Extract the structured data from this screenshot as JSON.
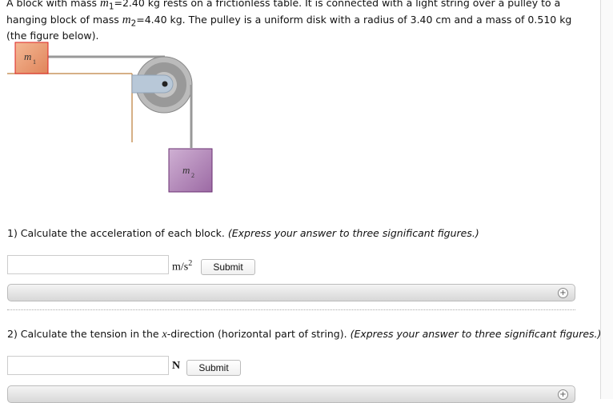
{
  "problem": {
    "part1": "A block with mass ",
    "m1": "m",
    "m1_sub": "1",
    "part2": "=2.40 kg rests on a frictionless table. It is connected with a light string over a pulley to a hanging block of mass ",
    "m2": "m",
    "m2_sub": "2",
    "part3": "=4.40 kg. The pulley is a uniform disk with a radius of 3.40 cm and a mass of 0.510 kg (the figure below)."
  },
  "figure": {
    "m1_label": "m",
    "m1_sub": "1",
    "m2_label": "m",
    "m2_sub": "2"
  },
  "questions": [
    {
      "text": "1) Calculate the acceleration of each block. ",
      "hint": "(Express your answer to three significant figures.)",
      "unit": "m/s",
      "unit_sup": "2",
      "value": "",
      "submit": "Submit",
      "expand": "+"
    },
    {
      "text_a": "2) Calculate the tension in the ",
      "var": "x",
      "text_b": "-direction (horizontal part of string). ",
      "hint": "(Express your answer to three significant figures.)",
      "unit": "N",
      "value": "",
      "submit": "Submit",
      "expand": "+"
    }
  ]
}
